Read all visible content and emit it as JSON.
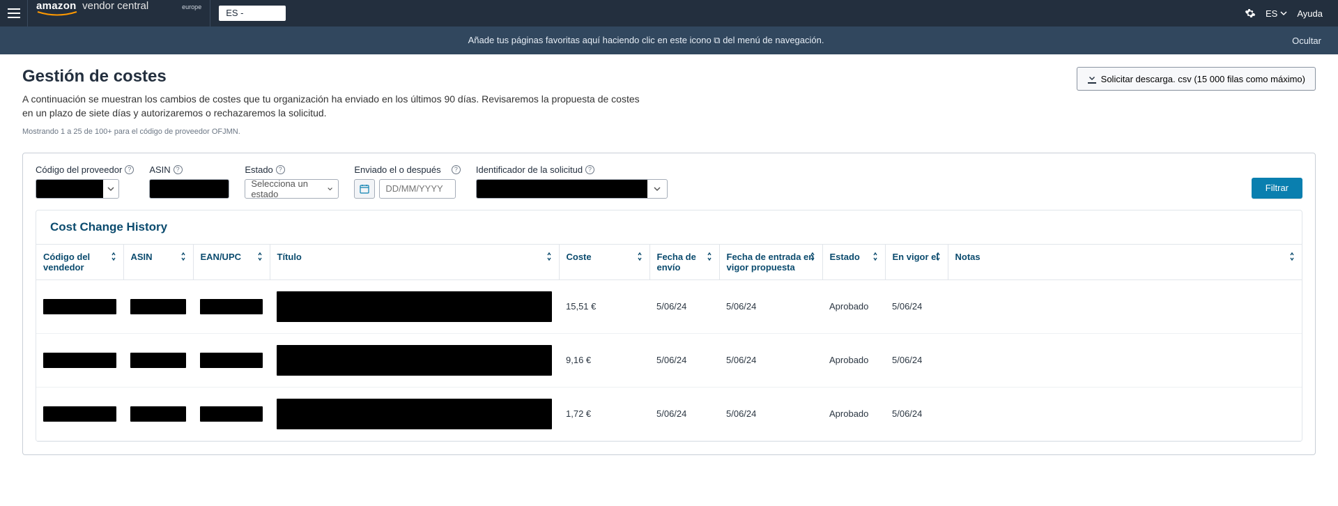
{
  "topbar": {
    "brand_amazon": "amazon",
    "brand_vc": "vendor central",
    "brand_region": "europe",
    "market": "ES -",
    "locale": "ES",
    "help": "Ayuda"
  },
  "favbar": {
    "message": "Añade tus páginas favoritas aquí haciendo clic en este icono ⧉ del menú de navegación.",
    "hide": "Ocultar"
  },
  "page": {
    "title": "Gestión de costes",
    "description": "A continuación se muestran los cambios de costes que tu organización ha enviado en los últimos 90 días. Revisaremos la propuesta de costes en un plazo de siete días y autorizaremos o rechazaremos la solicitud.",
    "count_line": "Mostrando 1 a 25 de 100+ para el código de proveedor OFJMN.",
    "download_button": "Solicitar descarga. csv (15 000 filas como máximo)"
  },
  "filters": {
    "vendor_label": "Código del proveedor",
    "asin_label": "ASIN",
    "state_label": "Estado",
    "state_placeholder": "Selecciona un estado",
    "submitted_label": "Enviado el o después",
    "date_placeholder": "DD/MM/YYYY",
    "request_label": "Identificador de la solicitud",
    "filter_button": "Filtrar"
  },
  "table": {
    "panel_title": "Cost Change History",
    "headers": {
      "vendor": "Código del vendedor",
      "asin": "ASIN",
      "ean": "EAN/UPC",
      "title": "Título",
      "cost": "Coste",
      "submitted": "Fecha de envío",
      "effective_proposed": "Fecha de entrada en vigor propuesta",
      "state": "Estado",
      "effective": "En vigor el",
      "notes": "Notas"
    },
    "rows": [
      {
        "cost": "15,51 €",
        "submitted": "5/06/24",
        "effective_proposed": "5/06/24",
        "state": "Aprobado",
        "effective": "5/06/24"
      },
      {
        "cost": "9,16 €",
        "submitted": "5/06/24",
        "effective_proposed": "5/06/24",
        "state": "Aprobado",
        "effective": "5/06/24"
      },
      {
        "cost": "1,72 €",
        "submitted": "5/06/24",
        "effective_proposed": "5/06/24",
        "state": "Aprobado",
        "effective": "5/06/24"
      }
    ]
  }
}
